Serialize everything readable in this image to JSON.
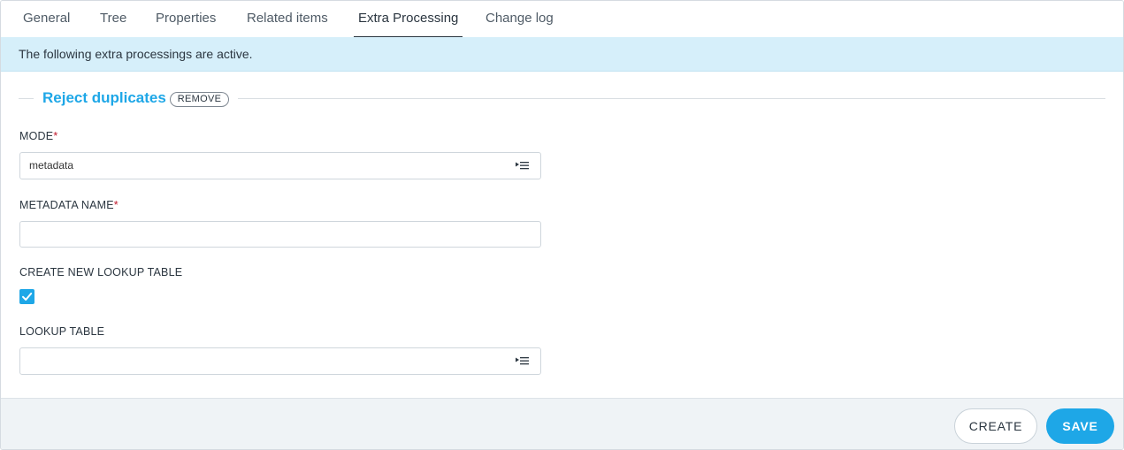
{
  "tabs": [
    {
      "label": "General"
    },
    {
      "label": "Tree"
    },
    {
      "label": "Properties"
    },
    {
      "label": "Related items"
    },
    {
      "label": "Extra Processing",
      "active": true
    },
    {
      "label": "Change log"
    }
  ],
  "banner": {
    "text": "The following extra processings are active."
  },
  "processing": {
    "title": "Reject duplicates",
    "remove_label": "REMOVE"
  },
  "form": {
    "mode": {
      "label": "MODE",
      "required_mark": "*",
      "value": "metadata",
      "icon": "list-select-icon"
    },
    "metadata_name": {
      "label": "METADATA NAME",
      "required_mark": "*",
      "value": ""
    },
    "create_lookup": {
      "label": "CREATE NEW LOOKUP TABLE",
      "checked": true
    },
    "lookup_table": {
      "label": "LOOKUP TABLE",
      "value": "",
      "icon": "list-select-icon"
    }
  },
  "footer": {
    "create_label": "CREATE",
    "save_label": "SAVE"
  },
  "colors": {
    "accent": "#1ea7e7",
    "banner_bg": "#d6effa",
    "required": "#c0182b",
    "footer_bg": "#eff3f6"
  }
}
